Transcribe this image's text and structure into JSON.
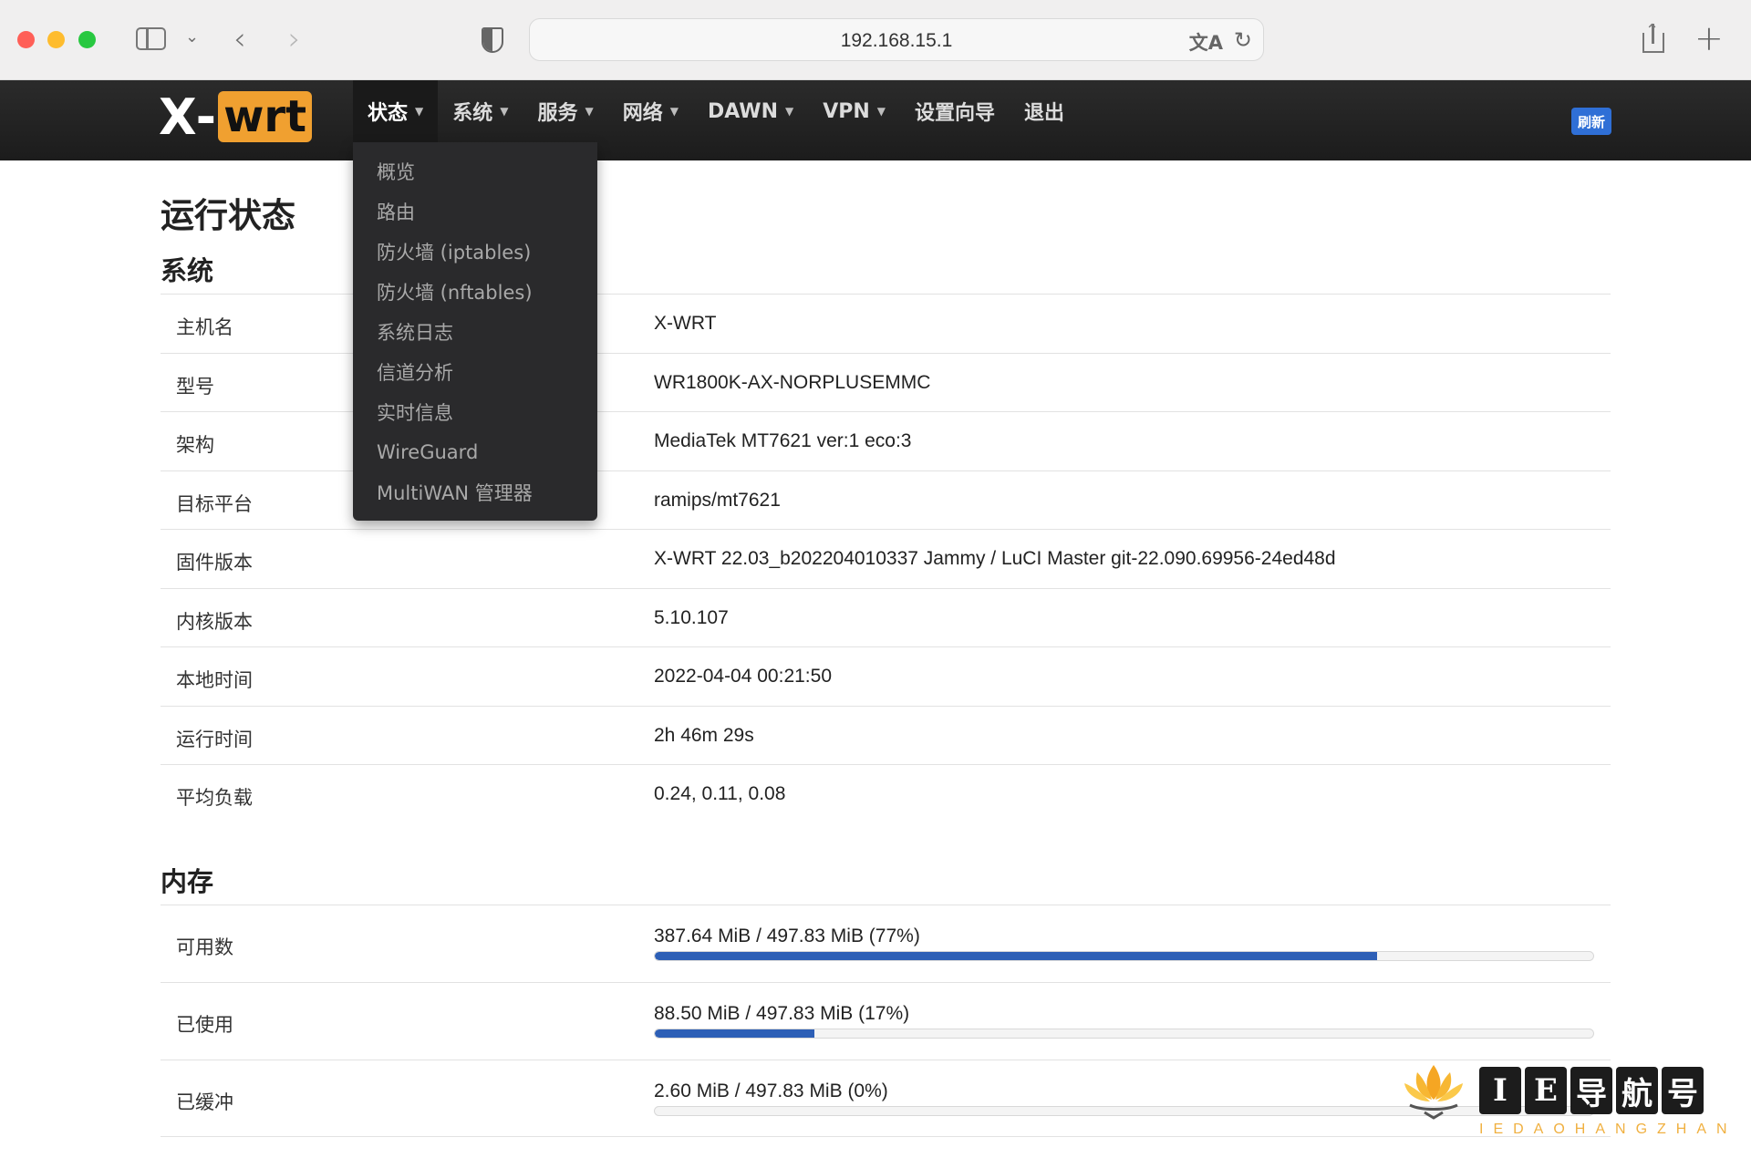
{
  "browser": {
    "url": "192.168.15.1",
    "icons": {
      "sidebar": "sidebar-toggle-icon",
      "back": "chevron-left-icon",
      "forward": "chevron-right-icon",
      "privacy": "shield-icon",
      "translate": "translate-icon",
      "reload": "reload-icon",
      "share": "share-icon",
      "new_tab": "plus-icon"
    }
  },
  "router": {
    "logo": {
      "x": "X",
      "dash": "-",
      "wrt": "wrt"
    },
    "menu": [
      {
        "label": "状态",
        "has_caret": true,
        "active": true
      },
      {
        "label": "系统",
        "has_caret": true
      },
      {
        "label": "服务",
        "has_caret": true
      },
      {
        "label": "网络",
        "has_caret": true
      },
      {
        "label": "DAWN",
        "has_caret": true
      },
      {
        "label": "VPN",
        "has_caret": true
      },
      {
        "label": "设置向导",
        "has_caret": false
      },
      {
        "label": "退出",
        "has_caret": false
      }
    ],
    "refresh_label": "刷新",
    "accent_color": "#2f6fd6",
    "logo_color": "#f0a030"
  },
  "dropdown": {
    "items": [
      "概览",
      "路由",
      "防火墙 (iptables)",
      "防火墙 (nftables)",
      "系统日志",
      "信道分析",
      "实时信息",
      "WireGuard",
      "MultiWAN 管理器"
    ]
  },
  "page": {
    "title": "运行状态",
    "system_section": "系统",
    "memory_section": "内存"
  },
  "system": [
    {
      "label": "主机名",
      "value": "X-WRT"
    },
    {
      "label": "型号",
      "value": "WR1800K-AX-NORPLUSEMMC"
    },
    {
      "label": "架构",
      "value": "MediaTek MT7621 ver:1 eco:3"
    },
    {
      "label": "目标平台",
      "value": "ramips/mt7621"
    },
    {
      "label": "固件版本",
      "value": "X-WRT 22.03_b202204010337 Jammy / LuCI Master git-22.090.69956-24ed48d"
    },
    {
      "label": "内核版本",
      "value": "5.10.107"
    },
    {
      "label": "本地时间",
      "value": "2022-04-04 00:21:50"
    },
    {
      "label": "运行时间",
      "value": "2h 46m 29s"
    },
    {
      "label": "平均负载",
      "value": "0.24, 0.11, 0.08"
    }
  ],
  "memory": [
    {
      "label": "可用数",
      "value": "387.64 MiB / 497.83 MiB (77%)",
      "fraction": 0.77
    },
    {
      "label": "已使用",
      "value": "88.50 MiB / 497.83 MiB (17%)",
      "fraction": 0.17
    },
    {
      "label": "已缓冲",
      "value": "2.60 MiB / 497.83 MiB (0%)",
      "fraction": 0.0
    }
  ],
  "watermark": {
    "chars": [
      "I",
      "E",
      "导",
      "航",
      "号"
    ],
    "sub": "IEDAOHANGZHAN"
  }
}
